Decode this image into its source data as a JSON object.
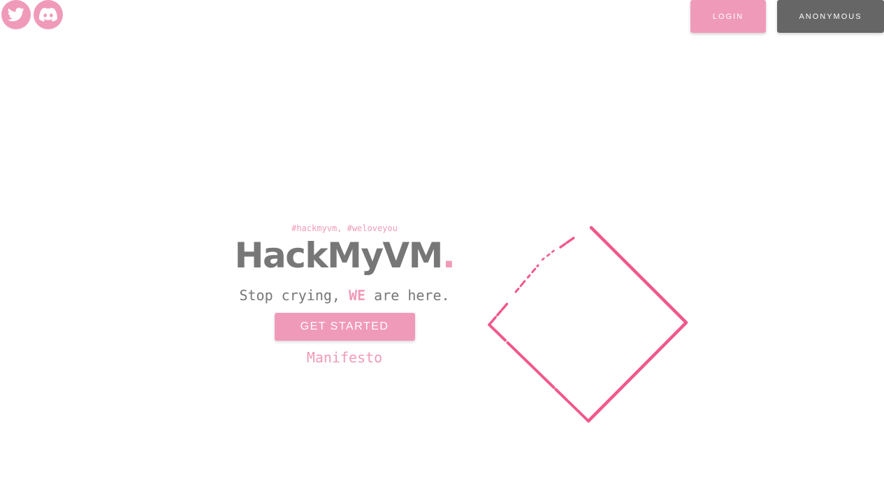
{
  "social": {
    "twitter_icon": "twitter-icon",
    "discord_icon": "discord-icon"
  },
  "header": {
    "login_label": "LOGIN",
    "anonymous_label": "ANONYMOUS"
  },
  "hero": {
    "tags": "#hackmyvm, #weloveyou",
    "title": "HackMyVM",
    "title_dot": ".",
    "tagline_before": "Stop crying, ",
    "tagline_we": "WE",
    "tagline_after": " are here.",
    "start_label": "GET STARTED",
    "manifesto_label": "Manifesto"
  },
  "colors": {
    "accent": "#f09ab9",
    "diamond": "#f0588a",
    "dark_button": "#666666",
    "text": "#777777"
  }
}
